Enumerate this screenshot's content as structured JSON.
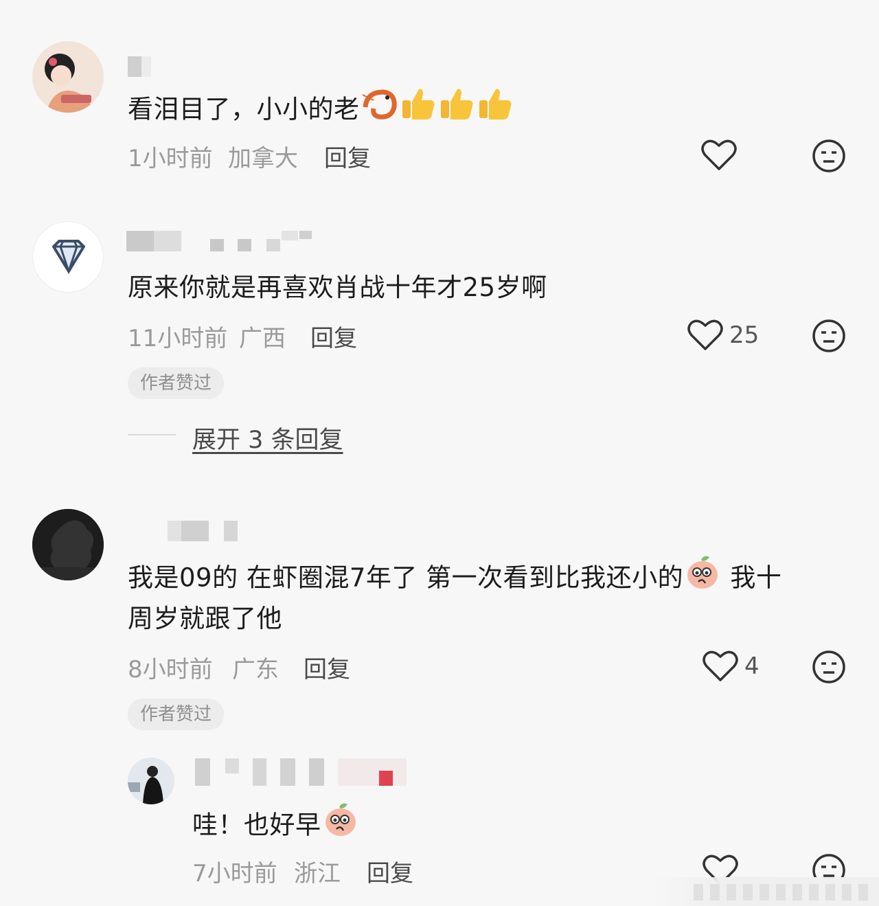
{
  "comments": [
    {
      "text": "看泪目了，小小的老",
      "time": "1小时前",
      "location": "加拿大",
      "reply_label": "回复",
      "emojis": [
        "shrimp-emoji",
        "thumbs-up-emoji",
        "thumbs-up-emoji",
        "thumbs-up-emoji"
      ]
    },
    {
      "text": "原来你就是再喜欢肖战十年才25岁啊",
      "time": "11小时前",
      "location": "广西",
      "reply_label": "回复",
      "like_count": "25",
      "badge": "作者赞过",
      "expand_label": "展开 3 条回复"
    },
    {
      "text_line1": "我是09的 在虾圈混7年了 第一次看到比我还小的",
      "text_line1_tail": "我十",
      "text_line2": "周岁就跟了他",
      "time": "8小时前",
      "location": "广东",
      "reply_label": "回复",
      "like_count": "4",
      "badge": "作者赞过",
      "reply": {
        "text": "哇！也好早",
        "time": "7小时前",
        "location": "浙江",
        "reply_label": "回复"
      }
    }
  ],
  "colors": {
    "background": "#f7f7f7",
    "text": "#1c1c1c",
    "meta": "#9a9a9a",
    "badge_bg": "#ececec"
  }
}
